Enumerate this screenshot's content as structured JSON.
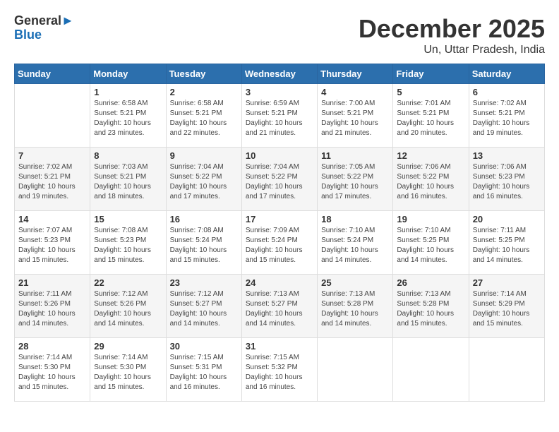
{
  "header": {
    "logo_line1": "General",
    "logo_line2": "Blue",
    "month_title": "December 2025",
    "location": "Un, Uttar Pradesh, India"
  },
  "weekdays": [
    "Sunday",
    "Monday",
    "Tuesday",
    "Wednesday",
    "Thursday",
    "Friday",
    "Saturday"
  ],
  "weeks": [
    [
      {
        "day": "",
        "info": ""
      },
      {
        "day": "1",
        "info": "Sunrise: 6:58 AM\nSunset: 5:21 PM\nDaylight: 10 hours\nand 23 minutes."
      },
      {
        "day": "2",
        "info": "Sunrise: 6:58 AM\nSunset: 5:21 PM\nDaylight: 10 hours\nand 22 minutes."
      },
      {
        "day": "3",
        "info": "Sunrise: 6:59 AM\nSunset: 5:21 PM\nDaylight: 10 hours\nand 21 minutes."
      },
      {
        "day": "4",
        "info": "Sunrise: 7:00 AM\nSunset: 5:21 PM\nDaylight: 10 hours\nand 21 minutes."
      },
      {
        "day": "5",
        "info": "Sunrise: 7:01 AM\nSunset: 5:21 PM\nDaylight: 10 hours\nand 20 minutes."
      },
      {
        "day": "6",
        "info": "Sunrise: 7:02 AM\nSunset: 5:21 PM\nDaylight: 10 hours\nand 19 minutes."
      }
    ],
    [
      {
        "day": "7",
        "info": "Sunrise: 7:02 AM\nSunset: 5:21 PM\nDaylight: 10 hours\nand 19 minutes."
      },
      {
        "day": "8",
        "info": "Sunrise: 7:03 AM\nSunset: 5:21 PM\nDaylight: 10 hours\nand 18 minutes."
      },
      {
        "day": "9",
        "info": "Sunrise: 7:04 AM\nSunset: 5:22 PM\nDaylight: 10 hours\nand 17 minutes."
      },
      {
        "day": "10",
        "info": "Sunrise: 7:04 AM\nSunset: 5:22 PM\nDaylight: 10 hours\nand 17 minutes."
      },
      {
        "day": "11",
        "info": "Sunrise: 7:05 AM\nSunset: 5:22 PM\nDaylight: 10 hours\nand 17 minutes."
      },
      {
        "day": "12",
        "info": "Sunrise: 7:06 AM\nSunset: 5:22 PM\nDaylight: 10 hours\nand 16 minutes."
      },
      {
        "day": "13",
        "info": "Sunrise: 7:06 AM\nSunset: 5:23 PM\nDaylight: 10 hours\nand 16 minutes."
      }
    ],
    [
      {
        "day": "14",
        "info": "Sunrise: 7:07 AM\nSunset: 5:23 PM\nDaylight: 10 hours\nand 15 minutes."
      },
      {
        "day": "15",
        "info": "Sunrise: 7:08 AM\nSunset: 5:23 PM\nDaylight: 10 hours\nand 15 minutes."
      },
      {
        "day": "16",
        "info": "Sunrise: 7:08 AM\nSunset: 5:24 PM\nDaylight: 10 hours\nand 15 minutes."
      },
      {
        "day": "17",
        "info": "Sunrise: 7:09 AM\nSunset: 5:24 PM\nDaylight: 10 hours\nand 15 minutes."
      },
      {
        "day": "18",
        "info": "Sunrise: 7:10 AM\nSunset: 5:24 PM\nDaylight: 10 hours\nand 14 minutes."
      },
      {
        "day": "19",
        "info": "Sunrise: 7:10 AM\nSunset: 5:25 PM\nDaylight: 10 hours\nand 14 minutes."
      },
      {
        "day": "20",
        "info": "Sunrise: 7:11 AM\nSunset: 5:25 PM\nDaylight: 10 hours\nand 14 minutes."
      }
    ],
    [
      {
        "day": "21",
        "info": "Sunrise: 7:11 AM\nSunset: 5:26 PM\nDaylight: 10 hours\nand 14 minutes."
      },
      {
        "day": "22",
        "info": "Sunrise: 7:12 AM\nSunset: 5:26 PM\nDaylight: 10 hours\nand 14 minutes."
      },
      {
        "day": "23",
        "info": "Sunrise: 7:12 AM\nSunset: 5:27 PM\nDaylight: 10 hours\nand 14 minutes."
      },
      {
        "day": "24",
        "info": "Sunrise: 7:13 AM\nSunset: 5:27 PM\nDaylight: 10 hours\nand 14 minutes."
      },
      {
        "day": "25",
        "info": "Sunrise: 7:13 AM\nSunset: 5:28 PM\nDaylight: 10 hours\nand 14 minutes."
      },
      {
        "day": "26",
        "info": "Sunrise: 7:13 AM\nSunset: 5:28 PM\nDaylight: 10 hours\nand 15 minutes."
      },
      {
        "day": "27",
        "info": "Sunrise: 7:14 AM\nSunset: 5:29 PM\nDaylight: 10 hours\nand 15 minutes."
      }
    ],
    [
      {
        "day": "28",
        "info": "Sunrise: 7:14 AM\nSunset: 5:30 PM\nDaylight: 10 hours\nand 15 minutes."
      },
      {
        "day": "29",
        "info": "Sunrise: 7:14 AM\nSunset: 5:30 PM\nDaylight: 10 hours\nand 15 minutes."
      },
      {
        "day": "30",
        "info": "Sunrise: 7:15 AM\nSunset: 5:31 PM\nDaylight: 10 hours\nand 16 minutes."
      },
      {
        "day": "31",
        "info": "Sunrise: 7:15 AM\nSunset: 5:32 PM\nDaylight: 10 hours\nand 16 minutes."
      },
      {
        "day": "",
        "info": ""
      },
      {
        "day": "",
        "info": ""
      },
      {
        "day": "",
        "info": ""
      }
    ]
  ]
}
